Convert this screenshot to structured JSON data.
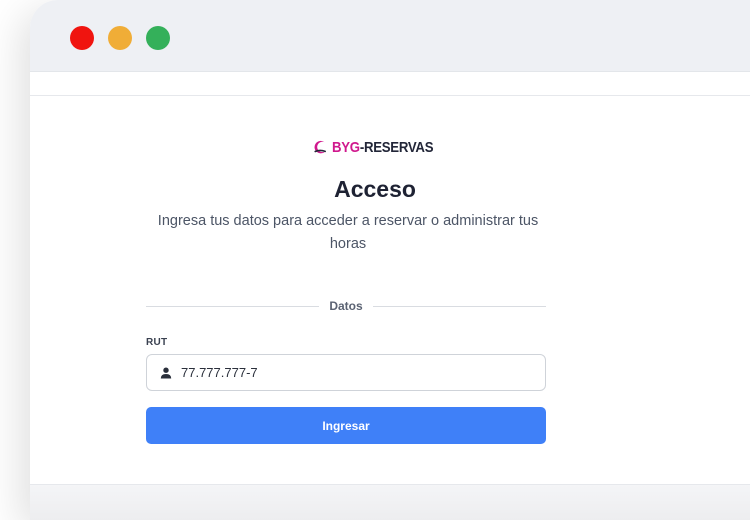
{
  "window": {
    "controls": [
      "close",
      "minimize",
      "maximize"
    ]
  },
  "logo": {
    "brand_prefix": "BYG",
    "brand_suffix": "-RESERVAS",
    "icon": "moon-logo-icon",
    "brand_color": "#d0188d"
  },
  "login": {
    "title": "Acceso",
    "subtitle": "Ingresa tus datos para acceder a reservar o administrar tus horas",
    "section_label": "Datos",
    "rut_label": "RUT",
    "rut_value": "77.777.777-7",
    "rut_icon": "user-icon",
    "submit_label": "Ingresar"
  },
  "colors": {
    "accent": "#3f80f8",
    "close": "#f0140f",
    "minimize": "#f0ad37",
    "maximize": "#34b05a"
  }
}
